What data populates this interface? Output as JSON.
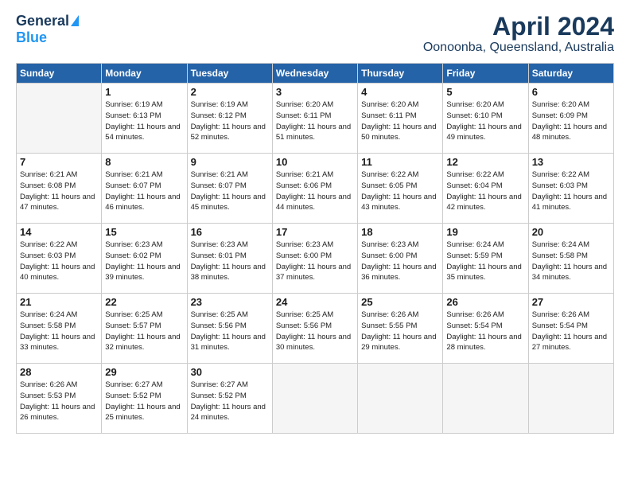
{
  "header": {
    "logo_general": "General",
    "logo_blue": "Blue",
    "month_title": "April 2024",
    "subtitle": "Oonoonba, Queensland, Australia"
  },
  "days_of_week": [
    "Sunday",
    "Monday",
    "Tuesday",
    "Wednesday",
    "Thursday",
    "Friday",
    "Saturday"
  ],
  "weeks": [
    [
      {
        "day": "",
        "empty": true
      },
      {
        "day": "1",
        "sunrise": "6:19 AM",
        "sunset": "6:13 PM",
        "daylight": "11 hours and 54 minutes."
      },
      {
        "day": "2",
        "sunrise": "6:19 AM",
        "sunset": "6:12 PM",
        "daylight": "11 hours and 52 minutes."
      },
      {
        "day": "3",
        "sunrise": "6:20 AM",
        "sunset": "6:11 PM",
        "daylight": "11 hours and 51 minutes."
      },
      {
        "day": "4",
        "sunrise": "6:20 AM",
        "sunset": "6:11 PM",
        "daylight": "11 hours and 50 minutes."
      },
      {
        "day": "5",
        "sunrise": "6:20 AM",
        "sunset": "6:10 PM",
        "daylight": "11 hours and 49 minutes."
      },
      {
        "day": "6",
        "sunrise": "6:20 AM",
        "sunset": "6:09 PM",
        "daylight": "11 hours and 48 minutes."
      }
    ],
    [
      {
        "day": "7",
        "sunrise": "6:21 AM",
        "sunset": "6:08 PM",
        "daylight": "11 hours and 47 minutes."
      },
      {
        "day": "8",
        "sunrise": "6:21 AM",
        "sunset": "6:07 PM",
        "daylight": "11 hours and 46 minutes."
      },
      {
        "day": "9",
        "sunrise": "6:21 AM",
        "sunset": "6:07 PM",
        "daylight": "11 hours and 45 minutes."
      },
      {
        "day": "10",
        "sunrise": "6:21 AM",
        "sunset": "6:06 PM",
        "daylight": "11 hours and 44 minutes."
      },
      {
        "day": "11",
        "sunrise": "6:22 AM",
        "sunset": "6:05 PM",
        "daylight": "11 hours and 43 minutes."
      },
      {
        "day": "12",
        "sunrise": "6:22 AM",
        "sunset": "6:04 PM",
        "daylight": "11 hours and 42 minutes."
      },
      {
        "day": "13",
        "sunrise": "6:22 AM",
        "sunset": "6:03 PM",
        "daylight": "11 hours and 41 minutes."
      }
    ],
    [
      {
        "day": "14",
        "sunrise": "6:22 AM",
        "sunset": "6:03 PM",
        "daylight": "11 hours and 40 minutes."
      },
      {
        "day": "15",
        "sunrise": "6:23 AM",
        "sunset": "6:02 PM",
        "daylight": "11 hours and 39 minutes."
      },
      {
        "day": "16",
        "sunrise": "6:23 AM",
        "sunset": "6:01 PM",
        "daylight": "11 hours and 38 minutes."
      },
      {
        "day": "17",
        "sunrise": "6:23 AM",
        "sunset": "6:00 PM",
        "daylight": "11 hours and 37 minutes."
      },
      {
        "day": "18",
        "sunrise": "6:23 AM",
        "sunset": "6:00 PM",
        "daylight": "11 hours and 36 minutes."
      },
      {
        "day": "19",
        "sunrise": "6:24 AM",
        "sunset": "5:59 PM",
        "daylight": "11 hours and 35 minutes."
      },
      {
        "day": "20",
        "sunrise": "6:24 AM",
        "sunset": "5:58 PM",
        "daylight": "11 hours and 34 minutes."
      }
    ],
    [
      {
        "day": "21",
        "sunrise": "6:24 AM",
        "sunset": "5:58 PM",
        "daylight": "11 hours and 33 minutes."
      },
      {
        "day": "22",
        "sunrise": "6:25 AM",
        "sunset": "5:57 PM",
        "daylight": "11 hours and 32 minutes."
      },
      {
        "day": "23",
        "sunrise": "6:25 AM",
        "sunset": "5:56 PM",
        "daylight": "11 hours and 31 minutes."
      },
      {
        "day": "24",
        "sunrise": "6:25 AM",
        "sunset": "5:56 PM",
        "daylight": "11 hours and 30 minutes."
      },
      {
        "day": "25",
        "sunrise": "6:26 AM",
        "sunset": "5:55 PM",
        "daylight": "11 hours and 29 minutes."
      },
      {
        "day": "26",
        "sunrise": "6:26 AM",
        "sunset": "5:54 PM",
        "daylight": "11 hours and 28 minutes."
      },
      {
        "day": "27",
        "sunrise": "6:26 AM",
        "sunset": "5:54 PM",
        "daylight": "11 hours and 27 minutes."
      }
    ],
    [
      {
        "day": "28",
        "sunrise": "6:26 AM",
        "sunset": "5:53 PM",
        "daylight": "11 hours and 26 minutes."
      },
      {
        "day": "29",
        "sunrise": "6:27 AM",
        "sunset": "5:52 PM",
        "daylight": "11 hours and 25 minutes."
      },
      {
        "day": "30",
        "sunrise": "6:27 AM",
        "sunset": "5:52 PM",
        "daylight": "11 hours and 24 minutes."
      },
      {
        "day": "",
        "empty": true
      },
      {
        "day": "",
        "empty": true
      },
      {
        "day": "",
        "empty": true
      },
      {
        "day": "",
        "empty": true
      }
    ]
  ]
}
